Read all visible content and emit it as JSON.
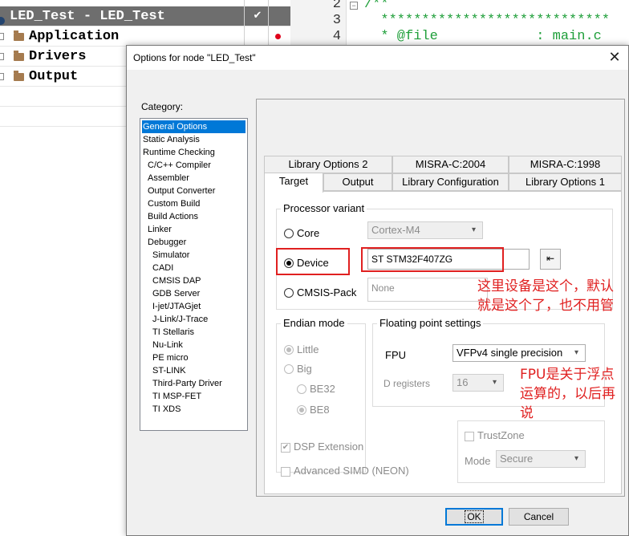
{
  "workspace": {
    "rows": [
      {
        "name": "LED_Test - LED_Test",
        "check": "✔",
        "selected": true
      },
      {
        "name": "Application",
        "dot": true
      },
      {
        "name": "Drivers"
      },
      {
        "name": "Output"
      }
    ]
  },
  "editor": {
    "lines": [
      {
        "num": "2",
        "text": "/**"
      },
      {
        "num": "3",
        "text": "  ****************************"
      },
      {
        "num": "4",
        "text": "  * @file            : main.c"
      }
    ]
  },
  "dialog": {
    "title": "Options for node \"LED_Test\"",
    "close": "✕",
    "category_label": "Category:",
    "categories": [
      "General Options",
      "Static Analysis",
      "Runtime Checking",
      "C/C++ Compiler",
      "Assembler",
      "Output Converter",
      "Custom Build",
      "Build Actions",
      "Linker",
      "Debugger",
      "Simulator",
      "CADI",
      "CMSIS DAP",
      "GDB Server",
      "I-jet/JTAGjet",
      "J-Link/J-Trace",
      "TI Stellaris",
      "Nu-Link",
      "PE micro",
      "ST-LINK",
      "Third-Party Driver",
      "TI MSP-FET",
      "TI XDS"
    ],
    "tabs_row1": [
      "Library Options 2",
      "MISRA-C:2004",
      "MISRA-C:1998"
    ],
    "tabs_row2": [
      "Target",
      "Output",
      "Library Configuration",
      "Library Options 1"
    ],
    "processor": {
      "group_title": "Processor variant",
      "core_label": "Core",
      "core_value": "Cortex-M4",
      "device_label": "Device",
      "device_value": "ST STM32F407ZG",
      "cmsis_label": "CMSIS-Pack",
      "cmsis_value": "None"
    },
    "endian": {
      "group_title": "Endian mode",
      "little": "Little",
      "big": "Big",
      "be32": "BE32",
      "be8": "BE8"
    },
    "fpu_group": {
      "group_title": "Floating point settings",
      "fpu_label": "FPU",
      "fpu_value": "VFPv4 single precision",
      "dreg_label": "D registers",
      "dreg_value": "16"
    },
    "dsp_label": "DSP Extension",
    "simd_label": "Advanced SIMD (NEON)",
    "trustzone_label": "TrustZone",
    "mode_label": "Mode",
    "mode_value": "Secure",
    "ok": "OK",
    "cancel": "Cancel"
  },
  "annotations": {
    "device_note": "这里设备是这个，默认就是这个了，也不用管",
    "fpu_note": "FPU是关于浮点运算的，以后再说"
  },
  "colors": {
    "accent": "#0078d7",
    "annotation": "#e02020",
    "code_comment": "#1f9f3a"
  }
}
